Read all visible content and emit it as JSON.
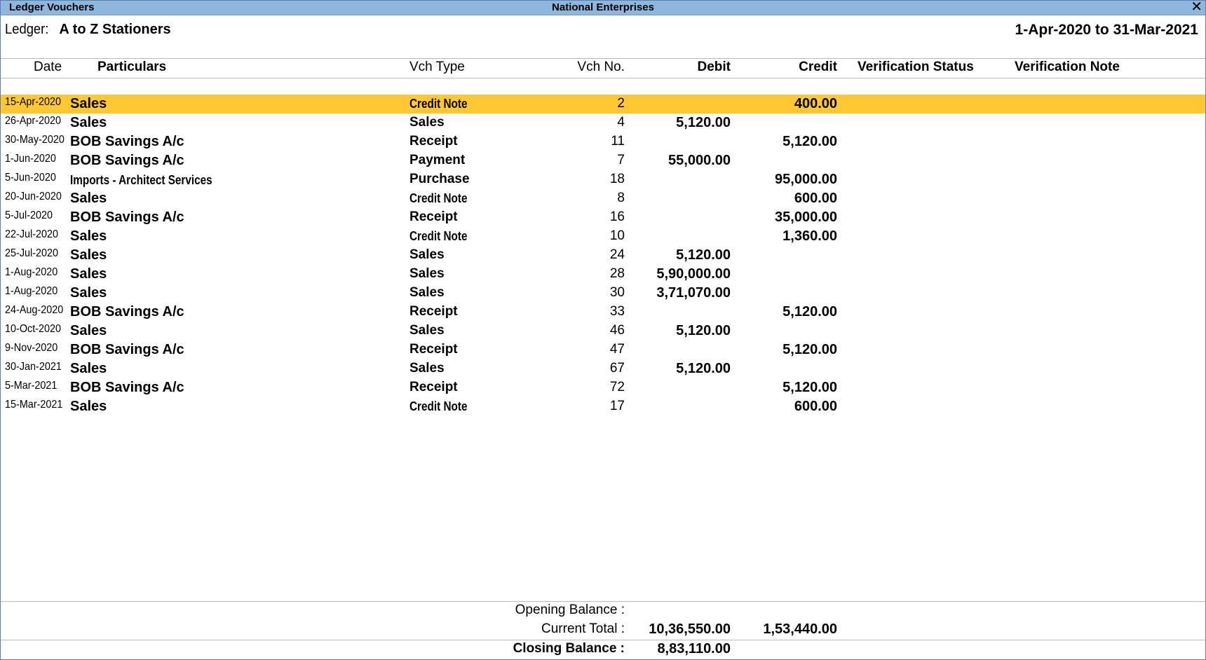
{
  "window": {
    "title": "Ledger Vouchers",
    "company": "National Enterprises",
    "close_glyph": "✕"
  },
  "ledger": {
    "label": "Ledger:",
    "name": "A to Z Stationers",
    "period": "1-Apr-2020 to 31-Mar-2021"
  },
  "columns": {
    "date": "Date",
    "particulars": "Particulars",
    "vch_type": "Vch Type",
    "vch_no": "Vch No.",
    "debit": "Debit",
    "credit": "Credit",
    "verification_status": "Verification Status",
    "verification_note": "Verification Note"
  },
  "rows": [
    {
      "date": "15-Apr-2020",
      "particulars": "Sales",
      "vch_type": "Credit Note",
      "vch_no": "2",
      "debit": "",
      "credit": "400.00",
      "selected": true
    },
    {
      "date": "26-Apr-2020",
      "particulars": "Sales",
      "vch_type": "Sales",
      "vch_no": "4",
      "debit": "5,120.00",
      "credit": ""
    },
    {
      "date": "30-May-2020",
      "particulars": "BOB Savings A/c",
      "vch_type": "Receipt",
      "vch_no": "11",
      "debit": "",
      "credit": "5,120.00"
    },
    {
      "date": "1-Jun-2020",
      "particulars": "BOB Savings A/c",
      "vch_type": "Payment",
      "vch_no": "7",
      "debit": "55,000.00",
      "credit": ""
    },
    {
      "date": "5-Jun-2020",
      "particulars": "Imports - Architect Services",
      "vch_type": "Purchase",
      "vch_no": "18",
      "debit": "",
      "credit": "95,000.00"
    },
    {
      "date": "20-Jun-2020",
      "particulars": "Sales",
      "vch_type": "Credit Note",
      "vch_no": "8",
      "debit": "",
      "credit": "600.00"
    },
    {
      "date": "5-Jul-2020",
      "particulars": "BOB Savings A/c",
      "vch_type": "Receipt",
      "vch_no": "16",
      "debit": "",
      "credit": "35,000.00"
    },
    {
      "date": "22-Jul-2020",
      "particulars": "Sales",
      "vch_type": "Credit Note",
      "vch_no": "10",
      "debit": "",
      "credit": "1,360.00"
    },
    {
      "date": "25-Jul-2020",
      "particulars": "Sales",
      "vch_type": "Sales",
      "vch_no": "24",
      "debit": "5,120.00",
      "credit": ""
    },
    {
      "date": "1-Aug-2020",
      "particulars": "Sales",
      "vch_type": "Sales",
      "vch_no": "28",
      "debit": "5,90,000.00",
      "credit": ""
    },
    {
      "date": "1-Aug-2020",
      "particulars": "Sales",
      "vch_type": "Sales",
      "vch_no": "30",
      "debit": "3,71,070.00",
      "credit": ""
    },
    {
      "date": "24-Aug-2020",
      "particulars": "BOB Savings A/c",
      "vch_type": "Receipt",
      "vch_no": "33",
      "debit": "",
      "credit": "5,120.00"
    },
    {
      "date": "10-Oct-2020",
      "particulars": "Sales",
      "vch_type": "Sales",
      "vch_no": "46",
      "debit": "5,120.00",
      "credit": ""
    },
    {
      "date": "9-Nov-2020",
      "particulars": "BOB Savings A/c",
      "vch_type": "Receipt",
      "vch_no": "47",
      "debit": "",
      "credit": "5,120.00"
    },
    {
      "date": "30-Jan-2021",
      "particulars": "Sales",
      "vch_type": "Sales",
      "vch_no": "67",
      "debit": "5,120.00",
      "credit": ""
    },
    {
      "date": "5-Mar-2021",
      "particulars": "BOB Savings A/c",
      "vch_type": "Receipt",
      "vch_no": "72",
      "debit": "",
      "credit": "5,120.00"
    },
    {
      "date": "15-Mar-2021",
      "particulars": "Sales",
      "vch_type": "Credit Note",
      "vch_no": "17",
      "debit": "",
      "credit": "600.00"
    }
  ],
  "footer": {
    "opening_label": "Opening Balance :",
    "current_label": "Current Total :",
    "current_debit": "10,36,550.00",
    "current_credit": "1,53,440.00",
    "closing_label": "Closing Balance :",
    "closing_debit": "8,83,110.00"
  },
  "colors": {
    "titlebar": "#8fb6dc",
    "selected_row": "#ffc833"
  }
}
